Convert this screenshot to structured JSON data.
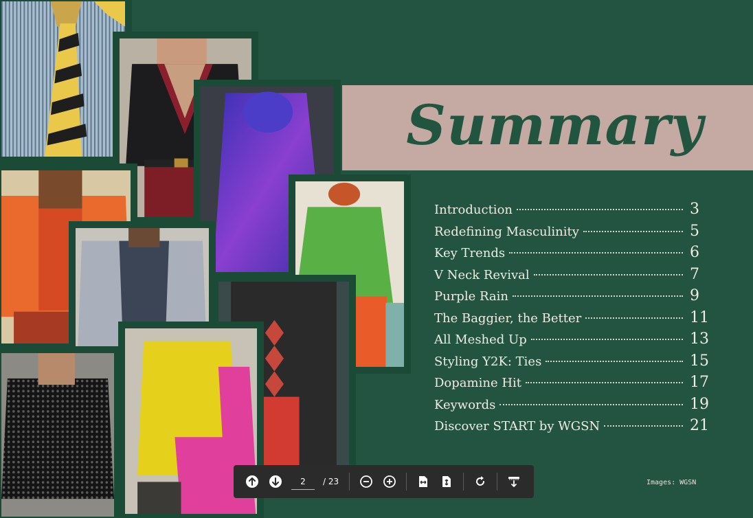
{
  "title": "Summary",
  "toc": [
    {
      "label": "Introduction",
      "page": "3"
    },
    {
      "label": "Redefining Masculinity",
      "page": "5"
    },
    {
      "label": "Key Trends",
      "page": "6"
    },
    {
      "label": "V Neck Revival",
      "page": "7"
    },
    {
      "label": "Purple Rain",
      "page": "9"
    },
    {
      "label": "The Baggier, the Better",
      "page": "11"
    },
    {
      "label": "All Meshed Up",
      "page": "13"
    },
    {
      "label": "Styling Y2K: Ties",
      "page": "15"
    },
    {
      "label": "Dopamine Hit",
      "page": "17"
    },
    {
      "label": "Keywords",
      "page": "19"
    },
    {
      "label": "Discover START by WGSN",
      "page": "21"
    }
  ],
  "credit": "Images: WGSN",
  "toolbar": {
    "current_page": "2",
    "total_pages": "/ 23",
    "icons": [
      "arrow-up-icon",
      "arrow-down-icon",
      "zoom-out-icon",
      "zoom-in-icon",
      "fit-width-icon",
      "fit-page-icon",
      "rotate-icon",
      "download-icon"
    ]
  },
  "colors": {
    "background": "#225441",
    "title_band": "#c4aaa3",
    "title_text": "#22553f",
    "toc_text": "#f1ece4",
    "toolbar": "#2b2b2b"
  }
}
